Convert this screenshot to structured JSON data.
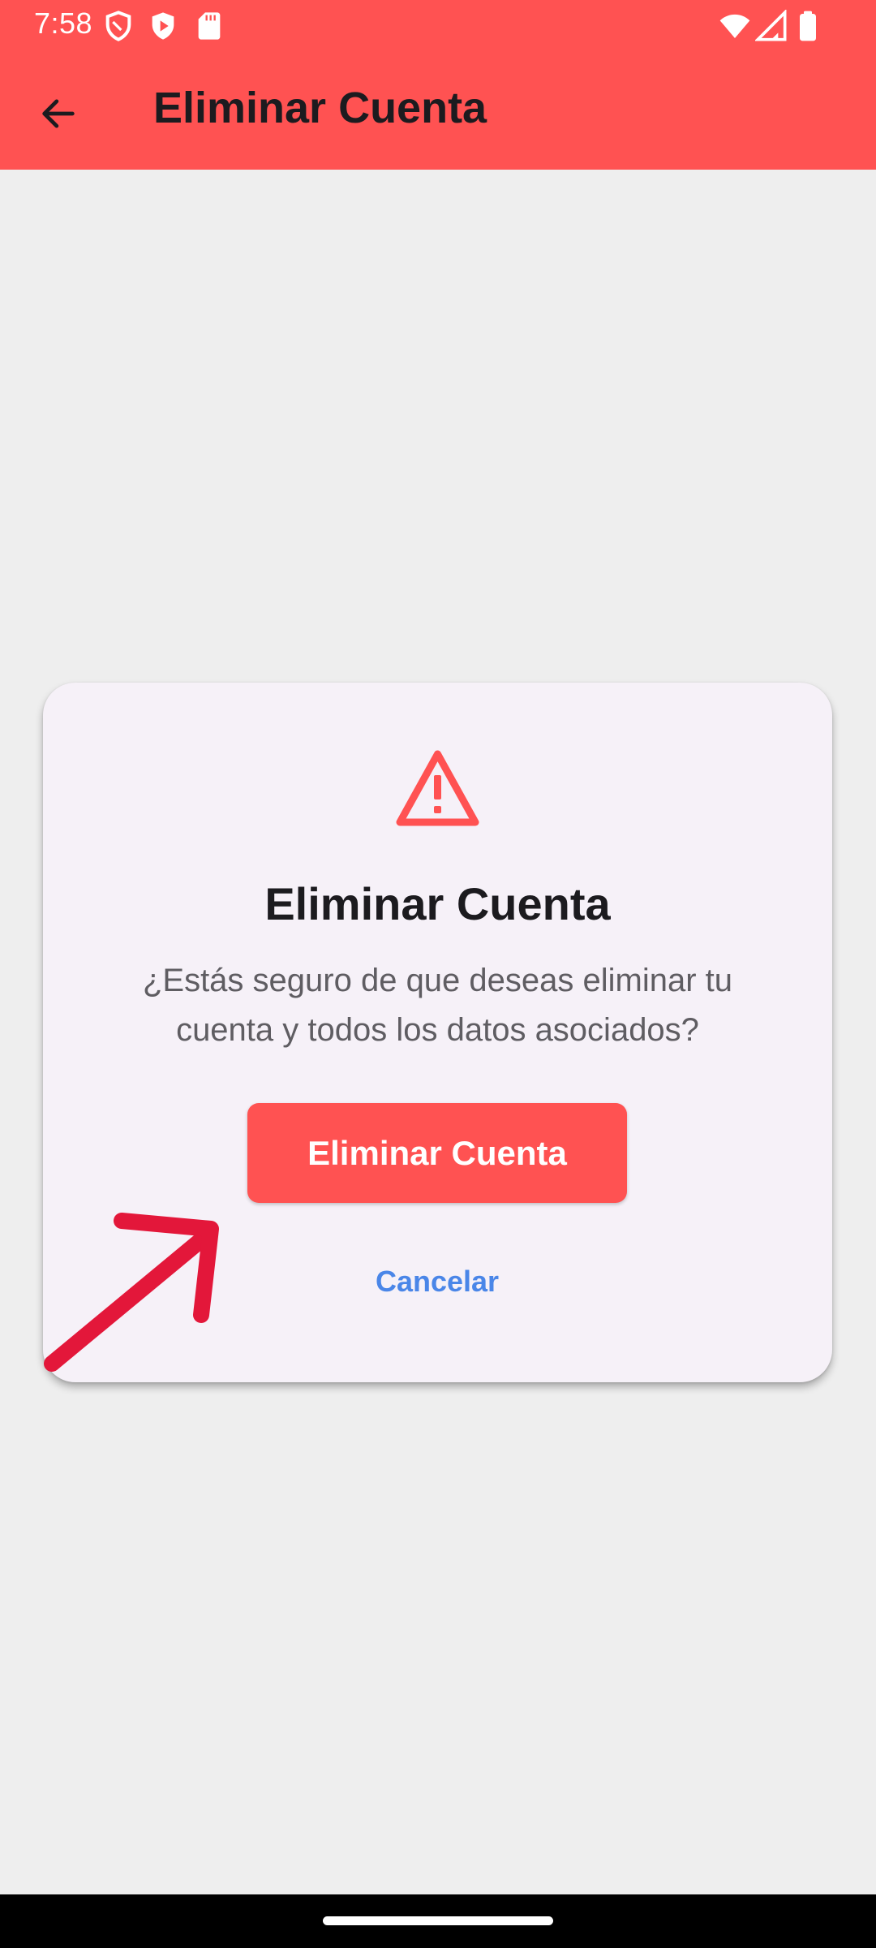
{
  "status_bar": {
    "time": "7:58",
    "left_icons": [
      "shield-icon",
      "play-shield-icon",
      "sd-card-icon"
    ],
    "right_icons": [
      "wifi-icon",
      "signal-icon",
      "battery-icon"
    ]
  },
  "toolbar": {
    "title": "Eliminar Cuenta",
    "back_icon": "arrow-back-icon",
    "background_color": "#ff5252"
  },
  "dialog": {
    "icon": "warning-icon",
    "icon_color": "#ff5252",
    "title": "Eliminar Cuenta",
    "message": "¿Estás seguro de que deseas eliminar tu cuenta y todos los datos asociados?",
    "confirm_label": "Eliminar Cuenta",
    "cancel_label": "Cancelar",
    "confirm_color": "#ff5252",
    "cancel_color": "#4a86e8"
  },
  "annotation": {
    "arrow_color": "#e3173a"
  }
}
